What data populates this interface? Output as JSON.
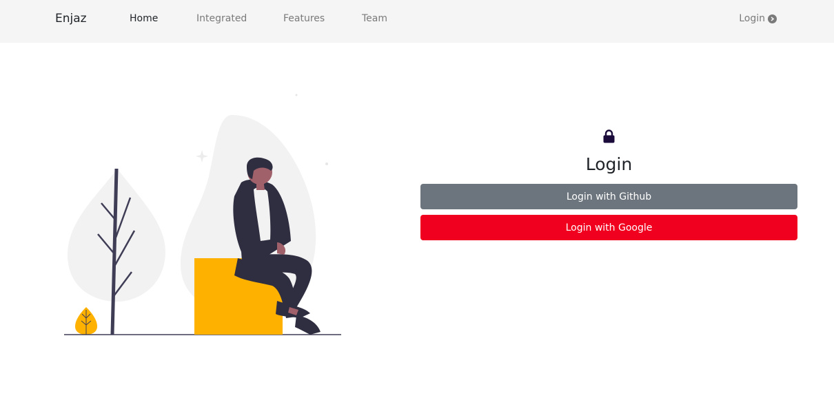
{
  "nav": {
    "brand": "Enjaz",
    "links": [
      {
        "label": "Home",
        "active": true
      },
      {
        "label": "Integrated",
        "active": false
      },
      {
        "label": "Features",
        "active": false
      },
      {
        "label": "Team",
        "active": false
      }
    ],
    "login_label": "Login",
    "login_icon": "arrow-circle-right-icon"
  },
  "login": {
    "icon": "lock-icon",
    "title": "Login",
    "github_label": "Login with Github",
    "google_label": "Login with Google"
  },
  "colors": {
    "navbar_bg": "#f5f5f5",
    "github_button": "#6c757d",
    "google_button": "#f0001e",
    "lock_icon": "#1a0b3a",
    "illustration_accent": "#ffb100",
    "illustration_dark": "#2f2e41"
  }
}
